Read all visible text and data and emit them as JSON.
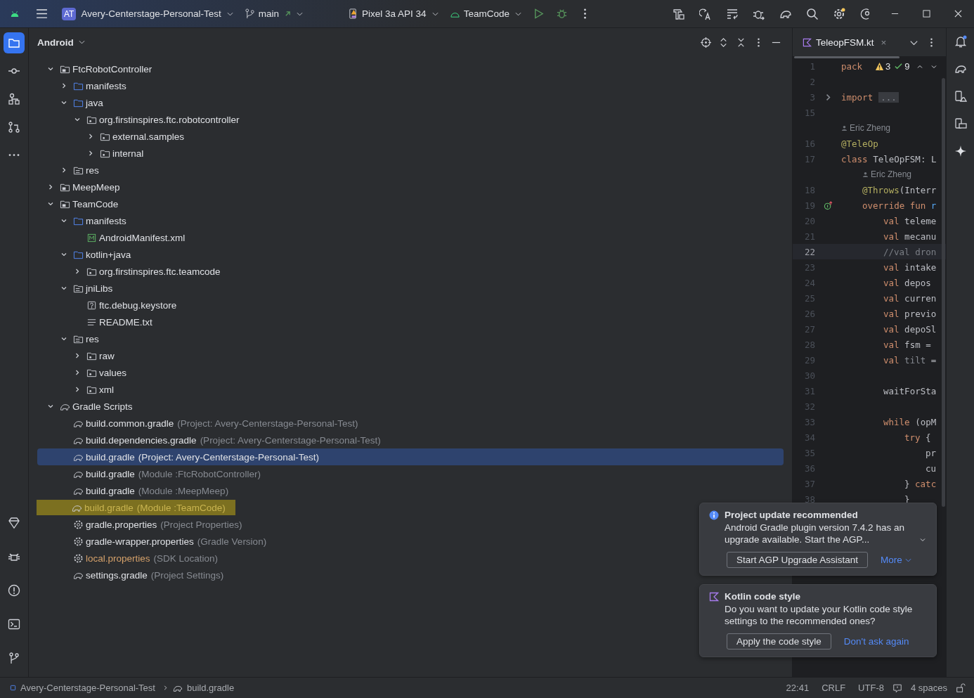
{
  "title_bar": {
    "project_badge": "AT",
    "project": "Avery-Centerstage-Personal-Test",
    "branch": "main",
    "device": "Pixel 3a API 34",
    "run_config": "TeamCode"
  },
  "left_toolbar": [
    {
      "kind": "folder",
      "selected": true
    },
    {
      "kind": "commit",
      "selected": false
    },
    {
      "kind": "structure",
      "selected": false
    },
    {
      "kind": "pull",
      "selected": false
    },
    {
      "kind": "more",
      "selected": false
    }
  ],
  "project": {
    "view": "Android",
    "tree": [
      {
        "label": "FtcRobotController",
        "kind": "module",
        "expanded": true,
        "selected": false,
        "children": [
          {
            "label": "manifests",
            "kind": "folder",
            "expanded": false,
            "selected": false
          },
          {
            "label": "java",
            "kind": "folder",
            "expanded": true,
            "selected": false,
            "children": [
              {
                "label": "org.firstinspires.ftc.robotcontroller",
                "kind": "package",
                "expanded": true,
                "selected": false,
                "children": [
                  {
                    "label": "external.samples",
                    "kind": "package",
                    "expanded": false,
                    "selected": false
                  },
                  {
                    "label": "internal",
                    "kind": "package",
                    "expanded": false,
                    "selected": false
                  }
                ]
              }
            ]
          },
          {
            "label": "res",
            "kind": "resfolder",
            "expanded": false,
            "selected": false
          }
        ]
      },
      {
        "label": "MeepMeep",
        "kind": "module",
        "expanded": false,
        "selected": false
      },
      {
        "label": "TeamCode",
        "kind": "module",
        "expanded": true,
        "selected": false,
        "children": [
          {
            "label": "manifests",
            "kind": "folder",
            "expanded": true,
            "selected": false,
            "children": [
              {
                "label": "AndroidManifest.xml",
                "kind": "manifest",
                "selected": false
              }
            ]
          },
          {
            "label": "kotlin+java",
            "kind": "folder",
            "expanded": true,
            "selected": false,
            "children": [
              {
                "label": "org.firstinspires.ftc.teamcode",
                "kind": "package",
                "expanded": false,
                "selected": false
              }
            ]
          },
          {
            "label": "jniLibs",
            "kind": "resfolder",
            "expanded": true,
            "selected": false,
            "children": [
              {
                "label": "ftc.debug.keystore",
                "kind": "unknown",
                "selected": false
              },
              {
                "label": "README.txt",
                "kind": "text",
                "selected": false
              }
            ]
          },
          {
            "label": "res",
            "kind": "resfolder",
            "expanded": true,
            "selected": false,
            "children": [
              {
                "label": "raw",
                "kind": "package",
                "expanded": false,
                "selected": false
              },
              {
                "label": "values",
                "kind": "package",
                "expanded": false,
                "selected": false
              },
              {
                "label": "xml",
                "kind": "package",
                "expanded": false,
                "selected": false
              }
            ]
          }
        ]
      },
      {
        "label": "Gradle Scripts",
        "kind": "gradle",
        "expanded": true,
        "selected": false,
        "children": [
          {
            "label": "build.common.gradle",
            "hint": "(Project: Avery-Centerstage-Personal-Test)",
            "kind": "gradle",
            "selected": false,
            "marked": false,
            "ignored": false
          },
          {
            "label": "build.dependencies.gradle",
            "hint": "(Project: Avery-Centerstage-Personal-Test)",
            "kind": "gradle",
            "selected": false,
            "marked": false,
            "ignored": false
          },
          {
            "label": "build.gradle",
            "hint": "(Project: Avery-Centerstage-Personal-Test)",
            "kind": "gradle",
            "selected": true,
            "marked": false,
            "ignored": false
          },
          {
            "label": "build.gradle",
            "hint": "(Module :FtcRobotController)",
            "kind": "gradle",
            "selected": false,
            "marked": false,
            "ignored": false
          },
          {
            "label": "build.gradle",
            "hint": "(Module :MeepMeep)",
            "kind": "gradle",
            "selected": false,
            "marked": false,
            "ignored": false
          },
          {
            "label": "build.gradle",
            "hint": "(Module :TeamCode)",
            "kind": "gradle",
            "selected": false,
            "marked": true,
            "ignored": false
          },
          {
            "label": "gradle.properties",
            "hint": "(Project Properties)",
            "kind": "gear",
            "selected": false,
            "marked": false,
            "ignored": false
          },
          {
            "label": "gradle-wrapper.properties",
            "hint": "(Gradle Version)",
            "kind": "gear",
            "selected": false,
            "marked": false,
            "ignored": false
          },
          {
            "label": "local.properties",
            "hint": "(SDK Location)",
            "kind": "gear",
            "selected": false,
            "marked": false,
            "ignored": true
          },
          {
            "label": "settings.gradle",
            "hint": "(Project Settings)",
            "kind": "gradle",
            "selected": false,
            "marked": false,
            "ignored": false
          }
        ]
      }
    ]
  },
  "editor": {
    "tabs": [
      {
        "label": "TeleopFSM.kt",
        "close": "×",
        "selected": true
      }
    ],
    "inspections": {
      "warnings": "3",
      "checks": "9"
    },
    "lines": [
      {
        "kind": "code",
        "number": "1",
        "current": false,
        "tokens": [
          {
            "kind": "keyword",
            "text": "pack"
          }
        ]
      },
      {
        "kind": "code",
        "number": "2",
        "current": false
      },
      {
        "kind": "folded",
        "number": "3",
        "current": false,
        "tokens": [
          {
            "kind": "keyword",
            "text": "import"
          },
          {
            "kind": "fold",
            "text": "..."
          }
        ]
      },
      {
        "kind": "code",
        "number": "15",
        "current": false
      },
      {
        "kind": "author",
        "text": "Eric Zheng"
      },
      {
        "kind": "code",
        "number": "16",
        "current": false,
        "tokens": [
          {
            "kind": "annotation",
            "text": "@TeleOp"
          }
        ]
      },
      {
        "kind": "code",
        "number": "17",
        "current": false,
        "tokens": [
          {
            "kind": "keyword",
            "text": "class"
          },
          {
            "kind": "plain",
            "text": " TeleOpFSM: L"
          }
        ]
      },
      {
        "kind": "author",
        "text": "    Eric Zheng"
      },
      {
        "kind": "code",
        "number": "18",
        "current": false,
        "tokens": [
          {
            "kind": "annotation",
            "text": "    @Throws"
          },
          {
            "kind": "plain",
            "text": "(Interr"
          }
        ]
      },
      {
        "kind": "override",
        "number": "19",
        "current": false,
        "tokens": [
          {
            "kind": "keyword",
            "text": "    override fun"
          },
          {
            "kind": "function",
            "text": " r"
          }
        ]
      },
      {
        "kind": "code",
        "number": "20",
        "current": false,
        "tokens": [
          {
            "kind": "keyword",
            "text": "        val"
          },
          {
            "kind": "plain",
            "text": " teleme"
          }
        ]
      },
      {
        "kind": "code",
        "number": "21",
        "current": false,
        "tokens": [
          {
            "kind": "keyword",
            "text": "        val"
          },
          {
            "kind": "plain",
            "text": " mecanu"
          }
        ]
      },
      {
        "kind": "code",
        "number": "22",
        "current": true,
        "tokens": [
          {
            "kind": "comment",
            "text": "        //val dron"
          }
        ]
      },
      {
        "kind": "code",
        "number": "23",
        "current": false,
        "tokens": [
          {
            "kind": "keyword",
            "text": "        val"
          },
          {
            "kind": "plain",
            "text": " intake"
          }
        ]
      },
      {
        "kind": "code",
        "number": "24",
        "current": false,
        "tokens": [
          {
            "kind": "keyword",
            "text": "        val"
          },
          {
            "kind": "plain",
            "text": " depos"
          }
        ]
      },
      {
        "kind": "code",
        "number": "25",
        "current": false,
        "tokens": [
          {
            "kind": "keyword",
            "text": "        val"
          },
          {
            "kind": "plain",
            "text": " curren"
          }
        ]
      },
      {
        "kind": "code",
        "number": "26",
        "current": false,
        "tokens": [
          {
            "kind": "keyword",
            "text": "        val"
          },
          {
            "kind": "plain",
            "text": " previo"
          }
        ]
      },
      {
        "kind": "code",
        "number": "27",
        "current": false,
        "tokens": [
          {
            "kind": "keyword",
            "text": "        val"
          },
          {
            "kind": "plain",
            "text": " depoSl"
          }
        ]
      },
      {
        "kind": "code",
        "number": "28",
        "current": false,
        "tokens": [
          {
            "kind": "keyword",
            "text": "        val"
          },
          {
            "kind": "plain",
            "text": " fsm ="
          }
        ]
      },
      {
        "kind": "code",
        "number": "29",
        "current": false,
        "tokens": [
          {
            "kind": "keyword",
            "text": "        val"
          },
          {
            "kind": "unused",
            "text": " tilt"
          },
          {
            "kind": "plain",
            "text": " ="
          }
        ]
      },
      {
        "kind": "code",
        "number": "30",
        "current": false
      },
      {
        "kind": "code",
        "number": "31",
        "current": false,
        "tokens": [
          {
            "kind": "plain",
            "text": "        waitForSta"
          }
        ]
      },
      {
        "kind": "code",
        "number": "32",
        "current": false
      },
      {
        "kind": "code",
        "number": "33",
        "current": false,
        "tokens": [
          {
            "kind": "keyword",
            "text": "        while"
          },
          {
            "kind": "plain",
            "text": " (opM"
          }
        ]
      },
      {
        "kind": "code",
        "number": "34",
        "current": false,
        "tokens": [
          {
            "kind": "keyword",
            "text": "            try"
          },
          {
            "kind": "plain",
            "text": " {"
          }
        ]
      },
      {
        "kind": "code",
        "number": "35",
        "current": false,
        "tokens": [
          {
            "kind": "plain",
            "text": "                pr"
          }
        ]
      },
      {
        "kind": "code",
        "number": "36",
        "current": false,
        "tokens": [
          {
            "kind": "plain",
            "text": "                cu"
          }
        ]
      },
      {
        "kind": "code",
        "number": "37",
        "current": false,
        "tokens": [
          {
            "kind": "plain",
            "text": "            }"
          },
          {
            "kind": "keyword",
            "text": " catc"
          }
        ]
      },
      {
        "kind": "code",
        "number": "38",
        "current": false,
        "tokens": [
          {
            "kind": "plain",
            "text": "            }"
          }
        ]
      }
    ]
  },
  "notifications": [
    {
      "kind": "info",
      "title": "Project update recommended",
      "body": "Android Gradle plugin version 7.4.2 has an upgrade available. Start the AGP...",
      "button": "Start AGP Upgrade Assistant",
      "link": "More",
      "expandable": true
    },
    {
      "kind": "kotlin",
      "title": "Kotlin code style",
      "body": "Do you want to update your Kotlin code style settings to the recommended ones?",
      "button": "Apply the code style",
      "link": "Don't ask again",
      "expandable": false
    }
  ],
  "status_bar": {
    "breadcrumbs": [
      "Avery-Centerstage-Personal-Test",
      "build.gradle"
    ],
    "position": "22:41",
    "line_separator": "CRLF",
    "encoding": "UTF-8",
    "indent": "4 spaces"
  }
}
